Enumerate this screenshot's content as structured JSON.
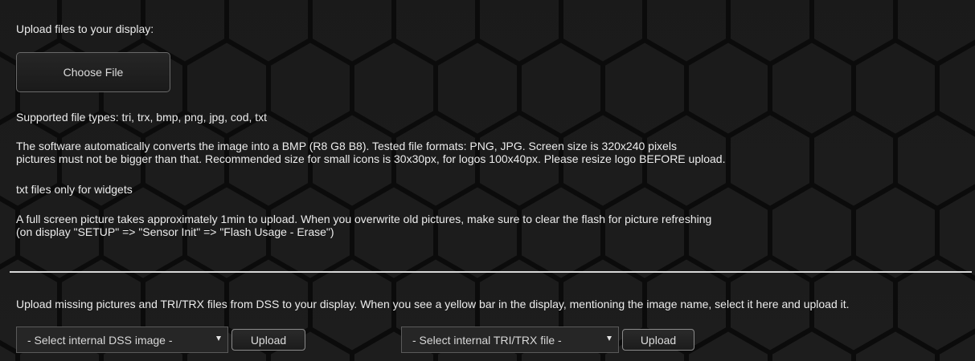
{
  "upload_section": {
    "heading": "Upload files to your display:",
    "choose_file_label": "Choose File",
    "supported_types": "Supported file types: tri, trx, bmp, png, jpg, cod, txt",
    "convert_line1": "The software automatically converts the image into a BMP (R8 G8 B8). Tested file formats: PNG, JPG. Screen size is 320x240 pixels",
    "convert_line2": "pictures must not be bigger than that. Recommended size for small icons is 30x30px, for logos 100x40px. Please resize logo BEFORE upload.",
    "txt_note": "txt files only for widgets",
    "fullscreen_line1": "A full screen picture takes approximately 1min to upload. When you overwrite old pictures, make sure to clear the flash for picture refreshing",
    "fullscreen_line2": "(on display \"SETUP\" => \"Sensor Init\" => \"Flash Usage - Erase\")"
  },
  "dss_section": {
    "instructions": "Upload missing pictures and TRI/TRX files from DSS to your display. When you see a yellow bar in the display, mentioning the image name, select it here and upload it.",
    "image_select_value": "- Select internal DSS image -",
    "image_upload_label": "Upload",
    "trx_select_value": "- Select internal TRI/TRX file -",
    "trx_upload_label": "Upload"
  },
  "colors": {
    "background": "#141414",
    "hex_cell": "#1c1c1c",
    "hex_gap": "#0a0a0a",
    "divider": "#d8d8d8"
  }
}
